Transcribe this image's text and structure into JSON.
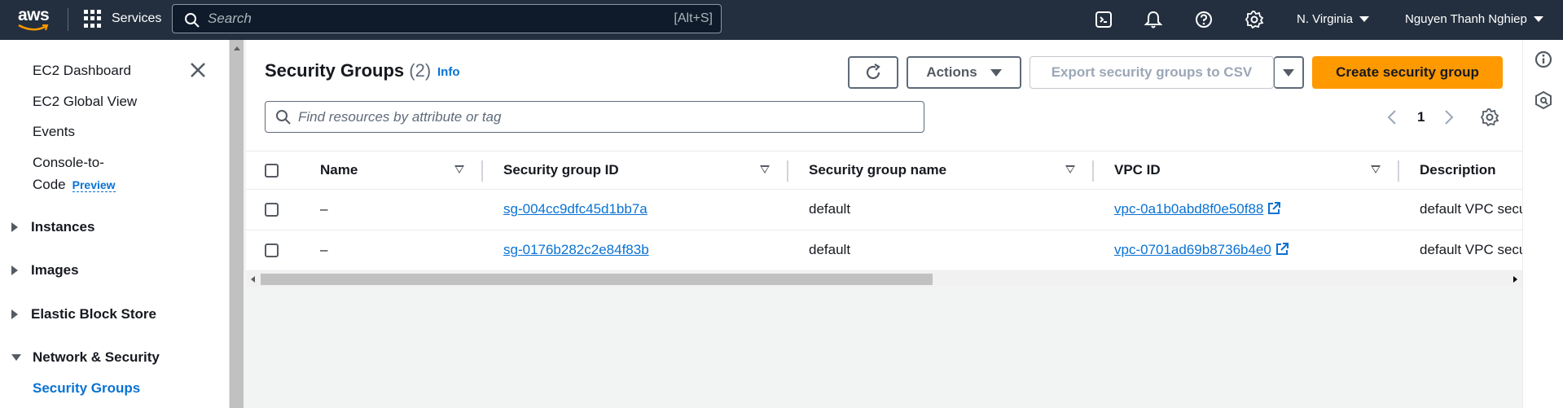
{
  "topnav": {
    "logo_text": "aws",
    "services_label": "Services",
    "search_placeholder": "Search",
    "search_shortcut": "[Alt+S]",
    "region": "N. Virginia",
    "user": "Nguyen Thanh Nghiep",
    "icons": [
      "cloudshell-icon",
      "notifications-icon",
      "help-icon",
      "settings-icon"
    ]
  },
  "sidebar": {
    "items": [
      "EC2 Dashboard",
      "EC2 Global View",
      "Events",
      "Console-to-",
      "Code"
    ],
    "preview_label": "Preview",
    "sections": [
      "Instances",
      "Images",
      "Elastic Block Store",
      "Network & Security"
    ],
    "active_item": "Security Groups"
  },
  "main": {
    "title": "Security Groups",
    "count": "(2)",
    "info_label": "Info",
    "actions_label": "Actions",
    "export_label": "Export security groups to CSV",
    "create_label": "Create security group",
    "filter_placeholder": "Find resources by attribute or tag",
    "page_number": "1"
  },
  "table": {
    "columns": [
      "Name",
      "Security group ID",
      "Security group name",
      "VPC ID",
      "Description"
    ],
    "rows": [
      {
        "name": "–",
        "sg_id": "sg-004cc9dfc45d1bb7a",
        "sg_name": "default",
        "vpc_id": "vpc-0a1b0abd8f0e50f88",
        "description": "default VPC secu"
      },
      {
        "name": "–",
        "sg_id": "sg-0176b282c2e84f83b",
        "sg_name": "default",
        "vpc_id": "vpc-0701ad69b8736b4e0",
        "description": "default VPC secu"
      }
    ]
  },
  "colors": {
    "nav_bg": "#232f3e",
    "primary": "#ff9900",
    "link": "#0972d3"
  }
}
